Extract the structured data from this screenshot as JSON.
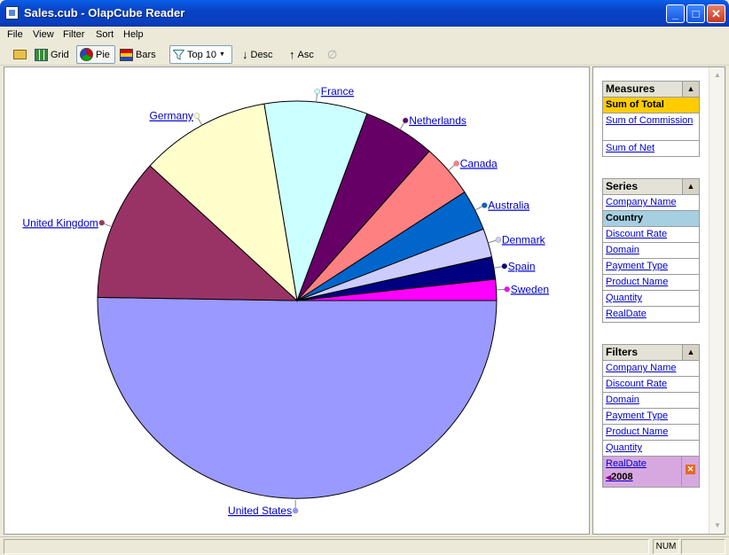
{
  "window": {
    "title": "Sales.cub - OlapCube Reader"
  },
  "menu": [
    "File",
    "View",
    "Filter",
    "Sort",
    "Help"
  ],
  "toolbar": {
    "grid_label": "Grid",
    "pie_label": "Pie",
    "bars_label": "Bars",
    "top_label": "Top 10",
    "desc_label": "Desc",
    "asc_label": "Asc"
  },
  "chart_data": {
    "type": "pie",
    "categories": [
      "United States",
      "United Kingdom",
      "Germany",
      "France",
      "Netherlands",
      "Canada",
      "Australia",
      "Denmark",
      "Spain",
      "Sweden"
    ],
    "values": [
      50.0,
      11.5,
      10.5,
      8.3,
      5.8,
      4.3,
      3.3,
      2.3,
      1.8,
      1.7
    ],
    "colors": [
      "#9999ff",
      "#993366",
      "#ffffcc",
      "#ccffff",
      "#660066",
      "#ff8080",
      "#0066cc",
      "#ccccff",
      "#000080",
      "#ff00ff"
    ]
  },
  "measures": {
    "header": "Measures",
    "items": [
      "Sum of Total",
      "Sum of Commission",
      "Sum of Net"
    ]
  },
  "series": {
    "header": "Series",
    "items": [
      "Company Name",
      "Country",
      "Discount Rate",
      "Domain",
      "Payment Type",
      "Product Name",
      "Quantity",
      "RealDate"
    ]
  },
  "filters": {
    "header": "Filters",
    "items": [
      "Company Name",
      "Discount Rate",
      "Domain",
      "Payment Type",
      "Product Name",
      "Quantity"
    ],
    "active_label": "RealDate",
    "active_value": "2008"
  },
  "status": {
    "num": "NUM"
  }
}
